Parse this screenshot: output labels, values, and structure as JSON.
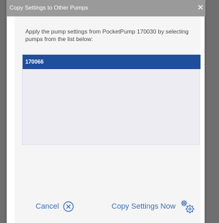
{
  "dialog": {
    "title": "Copy Settings to Other Pumps",
    "close_icon": "close-icon",
    "instructions": "Apply the pump settings from PocketPump 170030 by selecting pumps from the list below:"
  },
  "pump_list": {
    "items": [
      {
        "label": "170066",
        "selected": true
      }
    ]
  },
  "actions": {
    "cancel_label": "Cancel",
    "cancel_icon": "circle-x-icon",
    "copy_label": "Copy Settings Now",
    "copy_icon": "gears-icon"
  },
  "colors": {
    "titlebar": "#9a9a9a",
    "selected_row": "#1f4f9b",
    "link_blue": "#3d6fb8",
    "list_bg": "#ececf2"
  }
}
